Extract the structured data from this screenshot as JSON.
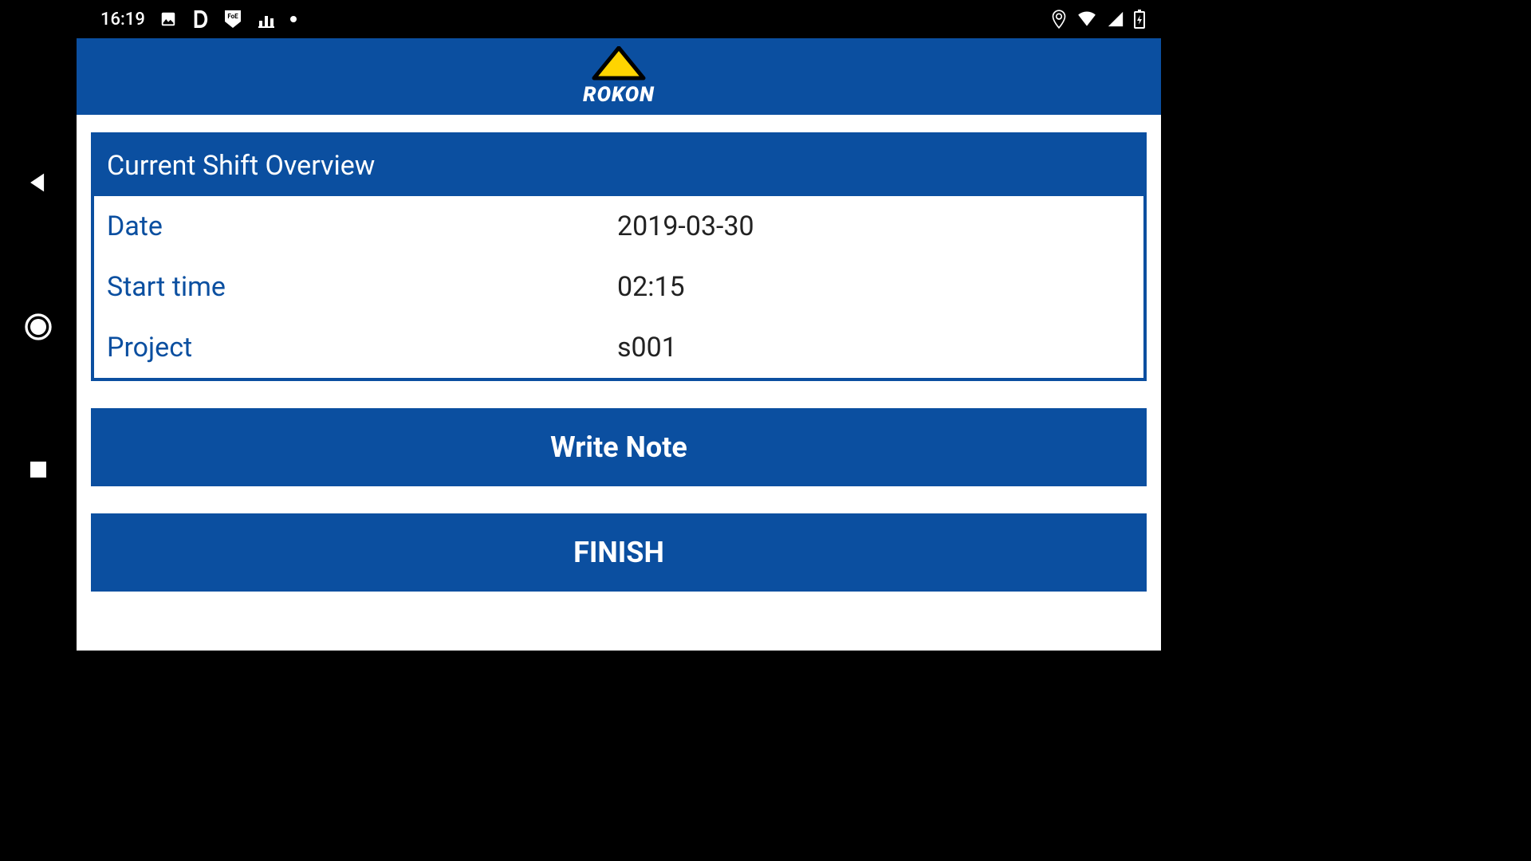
{
  "statusbar": {
    "time": "16:19"
  },
  "appbar": {
    "brand": "ROKON"
  },
  "card": {
    "title": "Current Shift Overview",
    "rows": {
      "date": {
        "label": "Date",
        "value": "2019-03-30"
      },
      "start": {
        "label": "Start time",
        "value": "02:15"
      },
      "project": {
        "label": "Project",
        "value": "s001"
      }
    }
  },
  "buttons": {
    "write_note": "Write Note",
    "finish": "FINISH"
  }
}
